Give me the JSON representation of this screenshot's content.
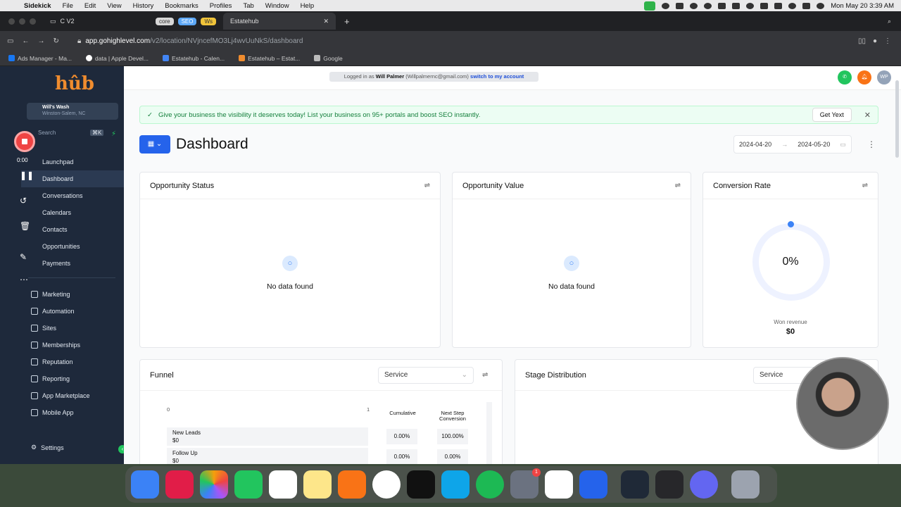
{
  "menubar": {
    "app": "Sidekick",
    "items": [
      "File",
      "Edit",
      "View",
      "History",
      "Bookmarks",
      "Profiles",
      "Tab",
      "Window",
      "Help"
    ],
    "clock": "Mon May 20  3:39 AM"
  },
  "browser": {
    "tabs": {
      "first": "C V2",
      "pill_core": "core",
      "pill_seo": "SEO",
      "pill_ws": "Ws",
      "active": "Estatehub"
    },
    "url_host": "app.gohighlevel.com",
    "url_path": "/v2/location/NVjncefMO3Lj4wvUuNkS/dashboard",
    "bookmarks": [
      "Ads Manager - Ma...",
      "data | Apple Devel...",
      "Estatehub - Calen...",
      "Estatehub – Estat...",
      "Google"
    ]
  },
  "sidebar": {
    "logo": "hûb",
    "account_name": "Will's Wash",
    "account_location": "Winston-Salem, NC",
    "search_placeholder": "Search",
    "search_shortcut": "⌘K",
    "items": [
      "Launchpad",
      "Dashboard",
      "Conversations",
      "Calendars",
      "Contacts",
      "Opportunities",
      "Payments"
    ],
    "items2": [
      "Marketing",
      "Automation",
      "Sites",
      "Memberships",
      "Reputation",
      "Reporting",
      "App Marketplace",
      "Mobile App"
    ],
    "settings": "Settings"
  },
  "recorder": {
    "time": "0:00"
  },
  "topbar": {
    "logged_prefix": "Logged in as",
    "user": "Will Palmer",
    "email": "(Willpalmernc@gmail.com)",
    "switch": "switch to my account",
    "avatar": "WP"
  },
  "banner": {
    "text": "Give your business the visibility it deserves today! List your business on 95+ portals and boost SEO instantly.",
    "button": "Get Yext"
  },
  "dashboard": {
    "title": "Dashboard",
    "date_from": "2024-04-20",
    "date_to": "2024-05-20"
  },
  "cards": {
    "opp_status": {
      "title": "Opportunity Status",
      "empty": "No data found"
    },
    "opp_value": {
      "title": "Opportunity Value",
      "empty": "No data found"
    },
    "conversion": {
      "title": "Conversion Rate",
      "percent": "0%",
      "won_label": "Won revenue",
      "won_value": "$0"
    },
    "funnel": {
      "title": "Funnel",
      "select": "Service",
      "axis_min": "0",
      "axis_max": "1",
      "col_cumulative": "Cumulative",
      "col_next": "Next Step Conversion",
      "rows": [
        {
          "stage": "New Leads",
          "value": "$0",
          "cumulative": "0.00%",
          "next": "100.00%"
        },
        {
          "stage": "Follow Up",
          "value": "$0",
          "cumulative": "0.00%",
          "next": "0.00%"
        }
      ]
    },
    "stage_dist": {
      "title": "Stage Distribution",
      "select": "Service"
    }
  },
  "colors": {
    "accent": "#2563eb",
    "sidebar_bg": "#1e293b",
    "logo": "#f08c2e",
    "banner_text": "#15803d"
  }
}
